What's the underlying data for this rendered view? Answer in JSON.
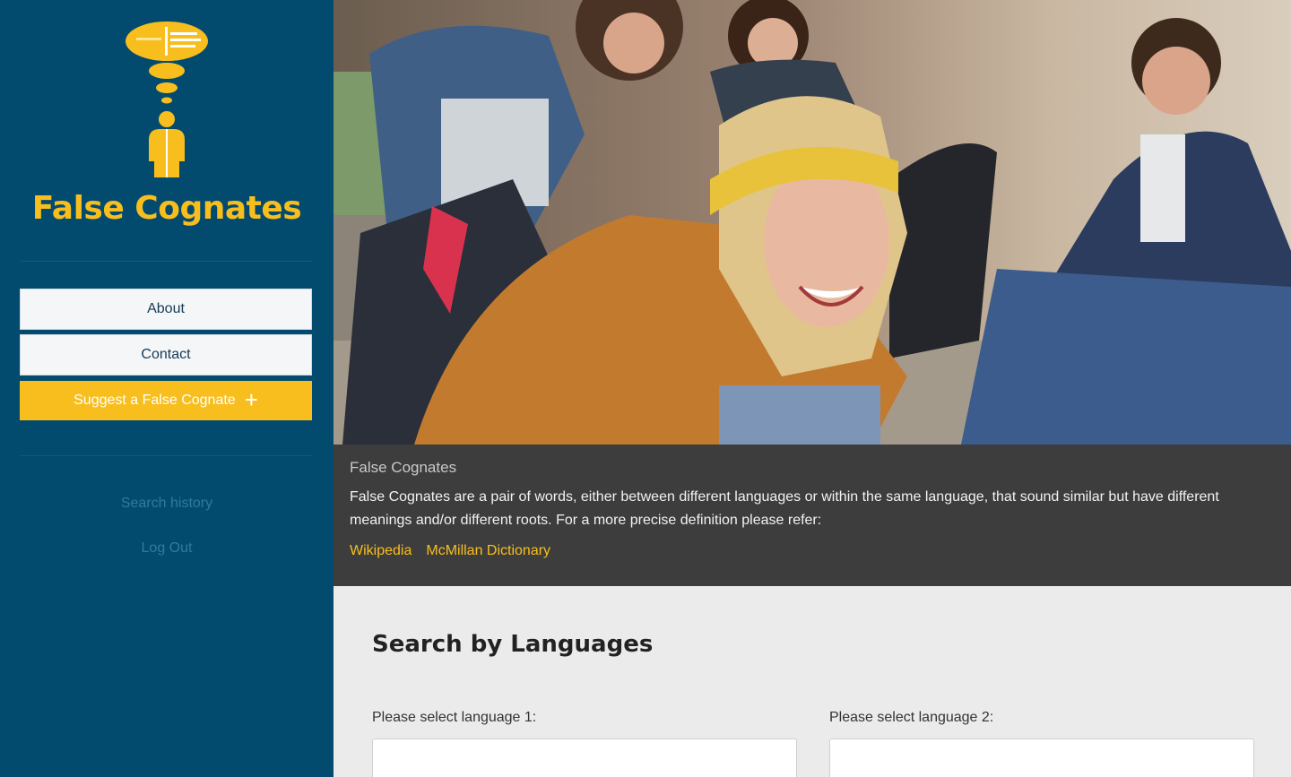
{
  "sidebar": {
    "brand": "False Cognates",
    "nav": {
      "about_label": "About",
      "contact_label": "Contact",
      "suggest_label": "Suggest a False Cognate",
      "suggest_icon": "plus-icon"
    },
    "links": {
      "search_history": "Search history",
      "log_out": "Log Out"
    }
  },
  "hero": {
    "description_icon": "hero-photo-group-of-friends-laughing"
  },
  "info": {
    "title": "False Cognates",
    "description": "False Cognates are a pair of words, either between different languages or within the same language, that sound similar but have different meanings and/or different roots. For a more precise definition please refer:",
    "links": [
      "Wikipedia",
      "McMillan Dictionary"
    ]
  },
  "search": {
    "title": "Search by Languages",
    "language1_label": "Please select language 1:",
    "language2_label": "Please select language 2:",
    "language1_value": "",
    "language2_value": ""
  },
  "colors": {
    "sidebar_bg": "#034b6e",
    "accent": "#f8be1e",
    "info_bg": "#3d3d3d",
    "panel_bg": "#ebebeb"
  }
}
